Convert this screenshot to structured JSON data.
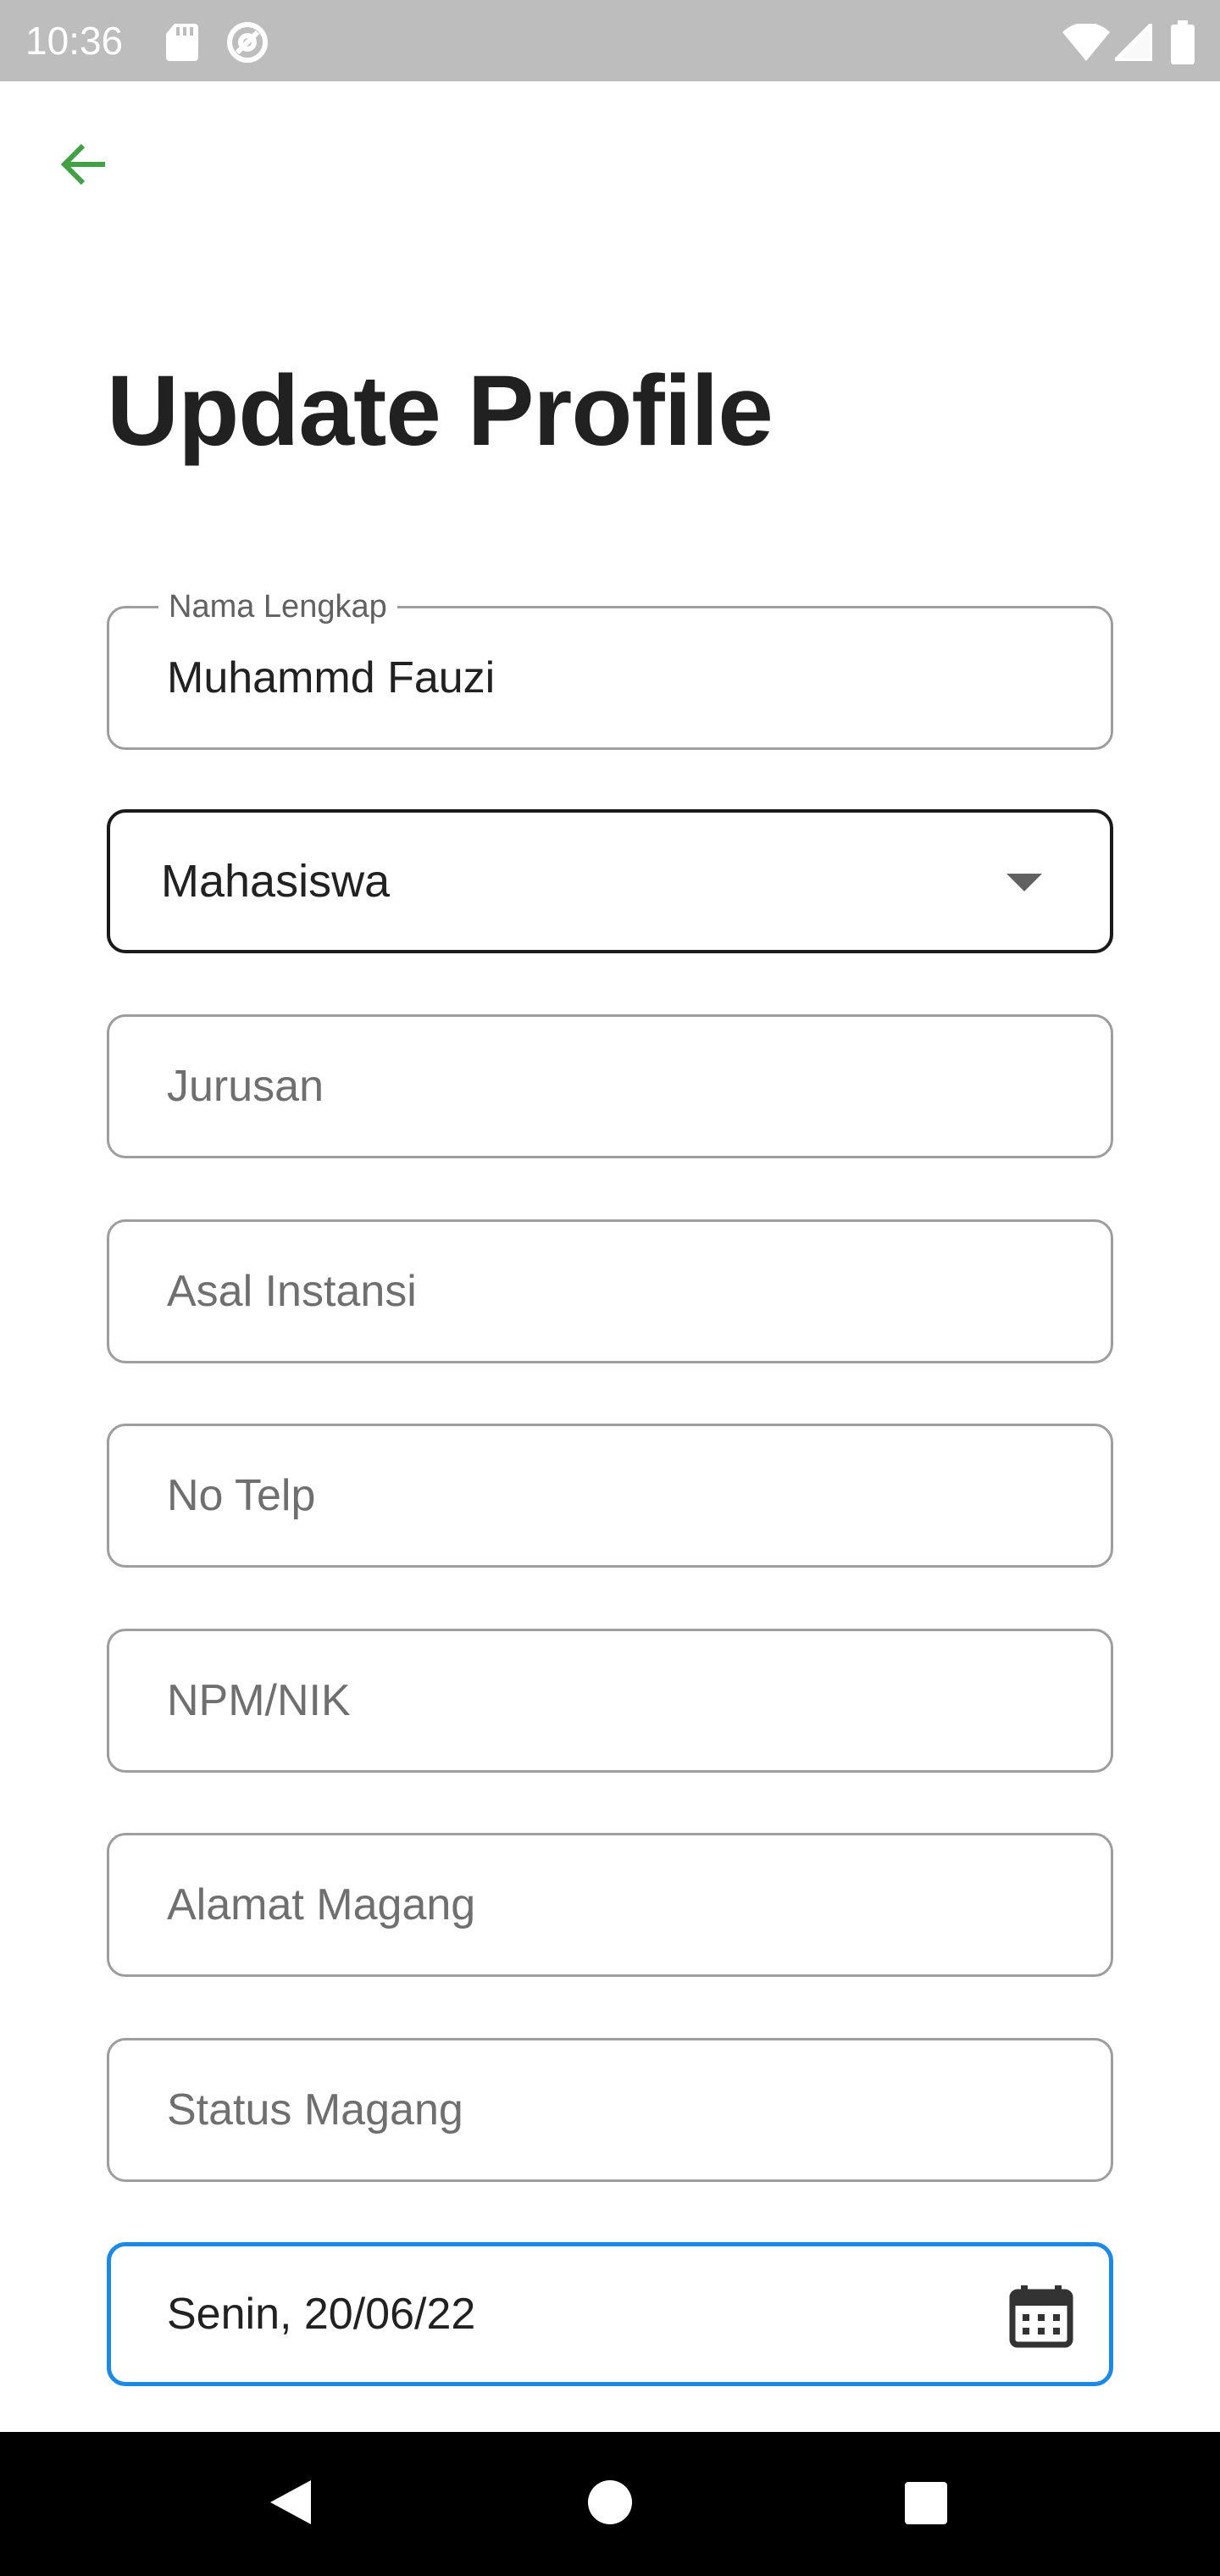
{
  "status_bar": {
    "time": "10:36",
    "left_icons": [
      "sd-card-icon",
      "at-sign-icon"
    ],
    "right_icons": [
      "wifi-icon",
      "signal-icon",
      "battery-icon"
    ],
    "color": "#bdbdbd"
  },
  "header": {
    "back_icon": "arrow-left-icon",
    "title": "Update Profile"
  },
  "form": {
    "nama_lengkap": {
      "label": "Nama Lengkap",
      "value": "Muhammd Fauzi"
    },
    "role_dropdown": {
      "selected": "Mahasiswa"
    },
    "jurusan": {
      "placeholder": "Jurusan",
      "value": ""
    },
    "asal_instansi": {
      "placeholder": "Asal Instansi",
      "value": ""
    },
    "no_telp": {
      "placeholder": "No Telp",
      "value": ""
    },
    "npm_nik": {
      "placeholder": "NPM/NIK",
      "value": ""
    },
    "alamat_magang": {
      "placeholder": "Alamat Magang",
      "value": ""
    },
    "status_magang": {
      "placeholder": "Status Magang",
      "value": ""
    },
    "tanggal": {
      "value": "Senin, 20/06/22",
      "icon": "calendar-icon"
    }
  },
  "colors": {
    "accent_green": "#43a047",
    "focus_blue": "#1e88e5",
    "title_text": "#212121"
  },
  "nav_bar": {
    "buttons": [
      "back-triangle-icon",
      "home-circle-icon",
      "recents-square-icon"
    ]
  }
}
